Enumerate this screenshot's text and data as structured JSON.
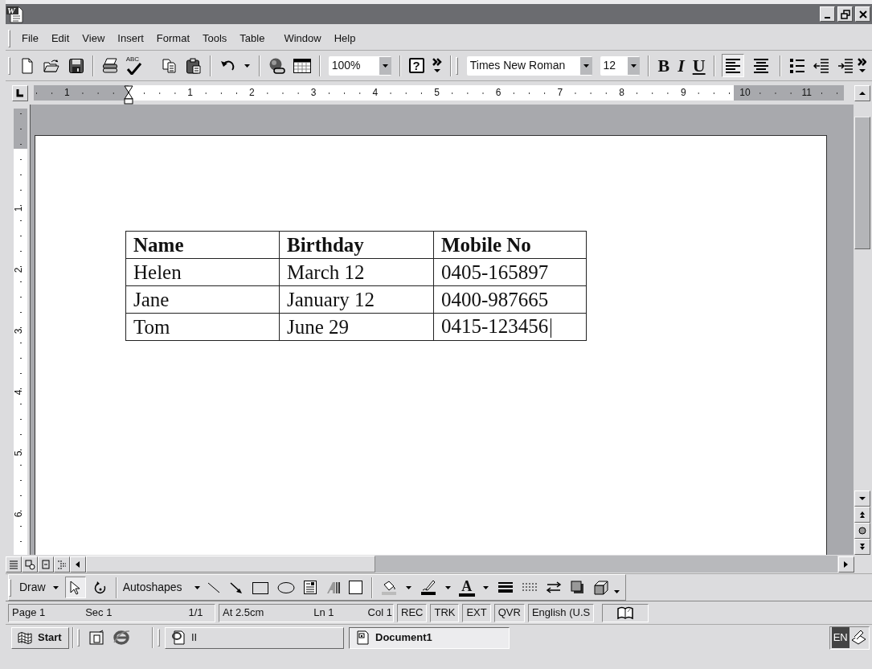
{
  "title_bar": {
    "icon_letter": "W"
  },
  "menu": [
    "File",
    "Edit",
    "View",
    "Insert",
    "Format",
    "Tools",
    "Table",
    "Window",
    "Help"
  ],
  "standard_toolbar": {
    "spelling_label": "ABC",
    "zoom": "100%",
    "help_label": "?"
  },
  "formatting_toolbar": {
    "font": "Times New Roman",
    "size": "12",
    "bold": "B",
    "italic": "I",
    "underline": "U",
    "alignment": [
      {
        "selected": true
      },
      {
        "selected": false
      }
    ]
  },
  "ruler": {
    "labels": [
      "1",
      "1",
      "2",
      "3",
      "4",
      "5",
      "6",
      "7",
      "8",
      "9",
      "10",
      "11"
    ]
  },
  "vertical_ruler": {
    "labels": [
      "1",
      "2",
      "3",
      "4",
      "5",
      "6"
    ]
  },
  "table": {
    "columns": [
      "Name",
      "Birthday",
      "Mobile No"
    ],
    "rows": [
      [
        "Helen",
        "March 12",
        "0405-165897"
      ],
      [
        "Jane",
        "January 12",
        "0400-987665"
      ],
      [
        "Tom",
        "June 29",
        "0415-123456"
      ]
    ]
  },
  "drawing_toolbar": {
    "draw": "Draw",
    "select_objects_selected": true,
    "autoshapes": "Autoshapes",
    "font_color_letter": "A"
  },
  "status_bar": {
    "panels": [
      [
        "Page 1",
        "Sec 1",
        "1/1"
      ],
      [
        "At 2.5cm",
        "Ln 1",
        "Col 1"
      ],
      [
        "REC"
      ],
      [
        "TRK"
      ],
      [
        "EXT"
      ],
      [
        "QVR"
      ],
      [
        "English (U.S"
      ]
    ]
  },
  "taskbar": {
    "start": "Start",
    "tasks": [
      {
        "label": "II",
        "selected": false
      },
      {
        "label": "Document1",
        "selected": true
      }
    ],
    "language": "EN"
  }
}
